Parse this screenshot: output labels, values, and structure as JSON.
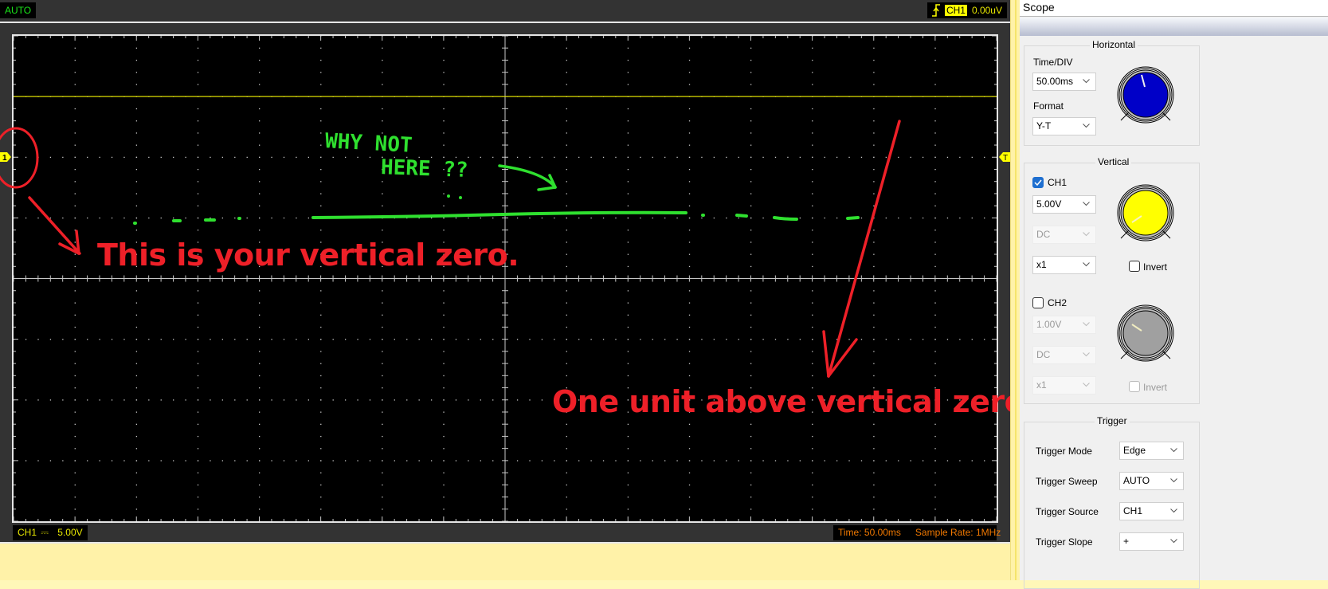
{
  "scope": {
    "mode_badge": "AUTO",
    "trigger_readout": {
      "channel": "CH1",
      "level": "0.00uV",
      "icon": "rising-edge-icon"
    },
    "ch1_readout": {
      "channel": "CH1",
      "coupling_symbol": "⎓",
      "scale": "5.00V"
    },
    "time_readout": {
      "time": "Time: 50.00ms",
      "sample_rate": "Sample Rate: 1MHz"
    },
    "markers": {
      "ch1": "1",
      "trigger": "T"
    },
    "colors": {
      "ch1": "#ffff00",
      "grid": "#c8c8c8",
      "trigger_line": "#d8d800",
      "annotation_red": "#ee2028",
      "annotation_green": "#2fe02f"
    },
    "grid": {
      "h_divisions": 16,
      "v_divisions": 8
    }
  },
  "annotations": {
    "vertical_zero": "This is your vertical zero.",
    "one_unit_above": "One unit above vertical zero",
    "why_not": "WHY  NOT",
    "here": "HERE ??"
  },
  "panel": {
    "title": "Scope",
    "horizontal": {
      "legend": "Horizontal",
      "time_div_label": "Time/DIV",
      "time_div_value": "50.00ms",
      "format_label": "Format",
      "format_value": "Y-T"
    },
    "vertical": {
      "legend": "Vertical",
      "ch1": {
        "label": "CH1",
        "checked": true,
        "volts": "5.00V",
        "coupling": "DC",
        "probe": "x1",
        "invert_label": "Invert",
        "invert": false
      },
      "ch2": {
        "label": "CH2",
        "checked": false,
        "volts": "1.00V",
        "coupling": "DC",
        "probe": "x1",
        "invert_label": "Invert",
        "invert": false
      }
    },
    "trigger": {
      "legend": "Trigger",
      "rows": [
        {
          "label": "Trigger Mode",
          "value": "Edge"
        },
        {
          "label": "Trigger Sweep",
          "value": "AUTO"
        },
        {
          "label": "Trigger Source",
          "value": "CH1"
        },
        {
          "label": "Trigger Slope",
          "value": "+"
        }
      ]
    }
  }
}
